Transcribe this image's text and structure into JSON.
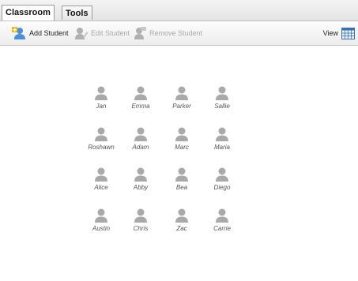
{
  "tabs": [
    {
      "label": "Classroom",
      "active": true
    },
    {
      "label": "Tools",
      "active": false
    }
  ],
  "toolbar": {
    "add_student": "Add Student",
    "edit_student": "Edit Student",
    "remove_student": "Remove Student",
    "view": "View"
  },
  "students": [
    [
      "Jan",
      "Emma",
      "Parker",
      "Sallie"
    ],
    [
      "Roshawn",
      "Adam",
      "Marc",
      "Maria"
    ],
    [
      "Alice",
      "Abby",
      "Bea",
      "Diego"
    ],
    [
      "Austin",
      "Chris",
      "Zac",
      "Carrie"
    ]
  ],
  "colors": {
    "avatar": "#a9a9a9",
    "add_icon_accent": "#f2b400",
    "view_icon": "#3a6fb0"
  }
}
